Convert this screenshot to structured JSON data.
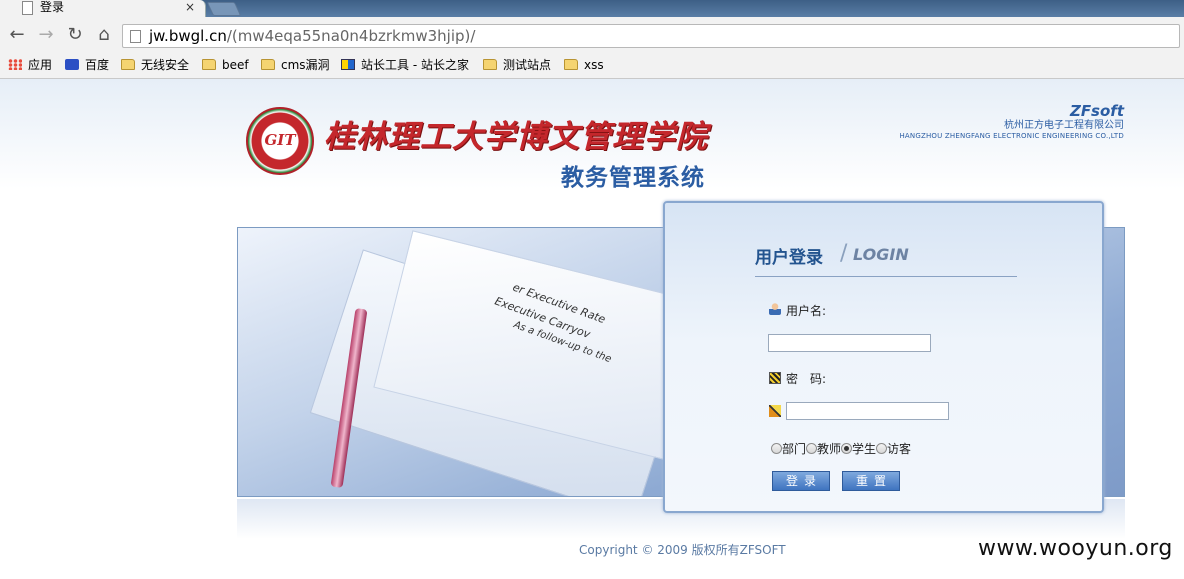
{
  "browser": {
    "tab_title": "登录",
    "tab_close": "×",
    "url_host": "jw.bwgl.cn",
    "url_path": "/(mw4eqa55na0n4bzrkmw3hjip)/",
    "nav": {
      "back": "←",
      "forward": "→",
      "reload": "↻",
      "home": "⌂"
    },
    "bookmarks": [
      {
        "label": "应用",
        "icon": "apps-icon"
      },
      {
        "label": "百度",
        "icon": "baidu-paw-icon"
      },
      {
        "label": "无线安全",
        "icon": "folder-icon"
      },
      {
        "label": "beef",
        "icon": "folder-icon"
      },
      {
        "label": "cms漏洞",
        "icon": "folder-icon"
      },
      {
        "label": "站长工具 - 站长之家",
        "icon": "chinaz-icon"
      },
      {
        "label": "测试站点",
        "icon": "folder-icon"
      },
      {
        "label": "xss",
        "icon": "folder-icon"
      }
    ]
  },
  "header": {
    "logo_text": "GIT",
    "school_name": "桂林理工大学博文管理学院",
    "system_name": "教务管理系统",
    "brand_name": "ZFsoft",
    "brand_cn": "杭州正方电子工程有限公司",
    "brand_en": "HANGZHOU ZHENGFANG ELECTRONIC ENGINEERING CO.,LTD"
  },
  "photo": {
    "text_line1": "er Executive Rate",
    "text_line2": "Executive Carryov",
    "text_line3": "As a follow-up to the"
  },
  "login": {
    "title_cn": "用户登录",
    "title_slash": "/",
    "title_en": "LOGIN",
    "username_label": "用户名:",
    "username_value": "",
    "password_label": "密　码:",
    "password_value": "",
    "roles": [
      {
        "label": "部门",
        "checked": false
      },
      {
        "label": "教师",
        "checked": false
      },
      {
        "label": "学生",
        "checked": true
      },
      {
        "label": "访客",
        "checked": false
      }
    ],
    "login_button": "登录",
    "reset_button": "重置"
  },
  "footer": {
    "copyright": "Copyright © 2009 版权所有ZFSOFT",
    "watermark": "www.wooyun.org"
  },
  "colors": {
    "accent_blue": "#2b5da3",
    "school_red": "#c4272c",
    "chrome_gray": "#f2f2f2"
  }
}
